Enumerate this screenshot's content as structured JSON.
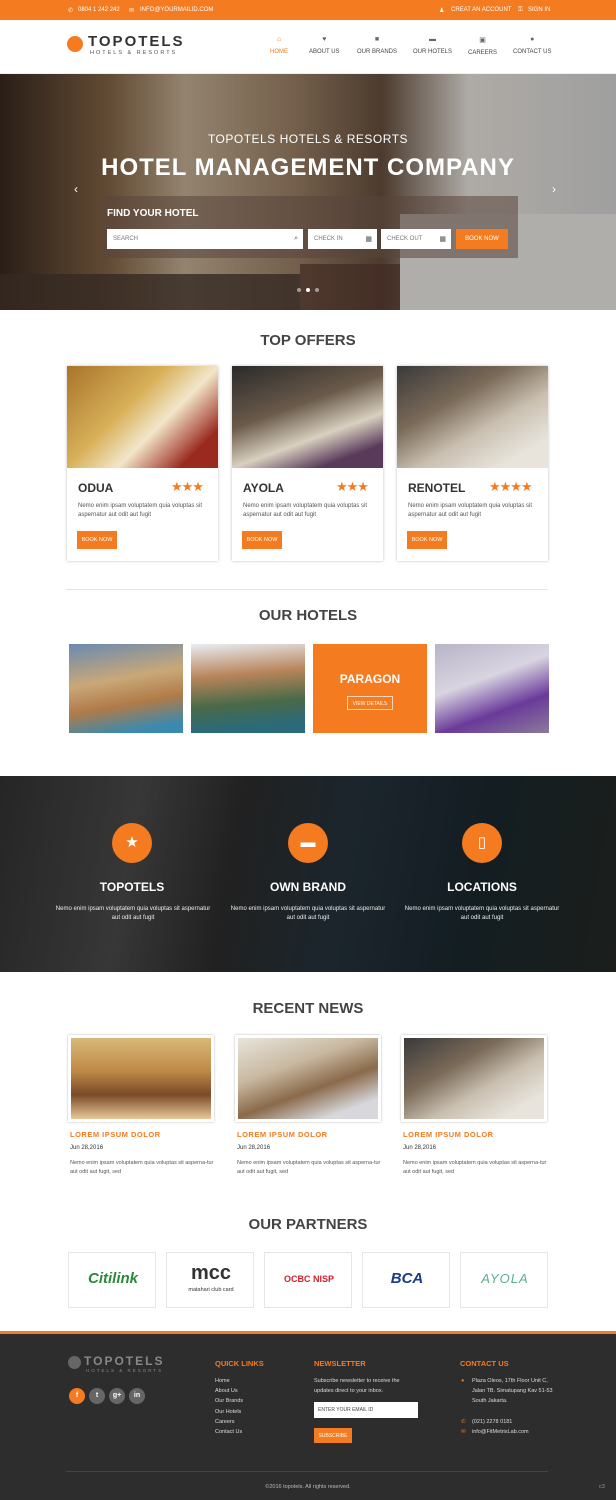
{
  "topbar": {
    "phone": "0804 1 242 242",
    "email": "INFO@YOURMAILID.COM",
    "create_account": "CREAT AN ACCOUNT",
    "sign_in": "SIGN IN"
  },
  "brand": {
    "name": "TOPOTELS",
    "tagline": "HOTELS & RESORTS",
    "accent": "#f47b20"
  },
  "nav": [
    {
      "label": "HOME",
      "icon": "home-icon",
      "glyph": "⌂"
    },
    {
      "label": "ABOUT US",
      "icon": "glass-icon",
      "glyph": "♥"
    },
    {
      "label": "OUR BRANDS",
      "icon": "book-icon",
      "glyph": "■"
    },
    {
      "label": "OUR HOTELS",
      "icon": "bed-icon",
      "glyph": "▬"
    },
    {
      "label": "CAREERS",
      "icon": "briefcase-icon",
      "glyph": "▣"
    },
    {
      "label": "CONTACT US",
      "icon": "map-marker-icon",
      "glyph": "●"
    }
  ],
  "hero": {
    "subtitle": "TOPOTELS HOTELS & RESORTS",
    "title": "HOTEL MANAGEMENT COMPANY",
    "find_label": "FIND YOUR HOTEL",
    "search_placeholder": "SEARCH",
    "checkin_placeholder": "CHECK IN",
    "checkout_placeholder": "CHECK OUT",
    "book_label": "BOOK NOW"
  },
  "offers": {
    "title": "TOP OFFERS",
    "items": [
      {
        "name": "ODUA",
        "stars": "★★★",
        "desc": "Nemo enim ipsam voluptatem quia voluptas sit aspernatur aut odit aut fugit",
        "button": "BOOK NOW"
      },
      {
        "name": "AYOLA",
        "stars": "★★★",
        "desc": "Nemo enim ipsam voluptatem quia voluptas sit aspernatur aut odit aut fugit",
        "button": "BOOK NOW"
      },
      {
        "name": "RENOTEL",
        "stars": "★★★★",
        "desc": "Nemo enim ipsam voluptatem quia voluptas sit aspernatur aut odit aut fugit",
        "button": "BOOK NOW"
      }
    ]
  },
  "hotels": {
    "title": "OUR HOTELS",
    "featured_name": "PARAGON",
    "featured_button": "VIEW DETAILS"
  },
  "features": [
    {
      "title": "TOPOTELS",
      "icon": "star-icon",
      "glyph": "★",
      "desc": "Nemo enim ipsam voluptatem quia voluptas sit aspernatur aut odit aut fugit"
    },
    {
      "title": "OWN BRAND",
      "icon": "bed-icon",
      "glyph": "▬",
      "desc": "Nemo enim ipsam voluptatem quia voluptas sit aspernatur aut odit aut fugit"
    },
    {
      "title": "LOCATIONS",
      "icon": "phone-icon",
      "glyph": "▯",
      "desc": "Nemo enim ipsam voluptatem quia voluptas sit aspernatur aut odit aut fugit"
    }
  ],
  "news": {
    "title": "RECENT NEWS",
    "items": [
      {
        "title": "LOREM IPSUM DOLOR",
        "date": "Jun 28,2016",
        "text": "Nemo enim ipsam voluptatem quia voluptas sit asperna-tur aut odit aut fugit, sed"
      },
      {
        "title": "LOREM IPSUM DOLOR",
        "date": "Jun 28,2016",
        "text": "Nemo enim ipsam voluptatem quia voluptas sit asperna-tur aut odit aut fugit, sed"
      },
      {
        "title": "LOREM IPSUM DOLOR",
        "date": "Jun 28,2016",
        "text": "Nemo enim ipsam voluptatem quia voluptas sit asperna-tur aut odit aut fugit, sed"
      }
    ]
  },
  "partners": {
    "title": "OUR PARTNERS",
    "items": [
      {
        "name": "Citilink",
        "sub": ""
      },
      {
        "name": "mcc",
        "sub": "matahari club card"
      },
      {
        "name": "OCBC NISP",
        "sub": ""
      },
      {
        "name": "BCA",
        "sub": ""
      },
      {
        "name": "AYOLA",
        "sub": ""
      }
    ]
  },
  "footer": {
    "quick_links_title": "QUICK LINKS",
    "quick_links": [
      "Home",
      "About Us",
      "Our Brands",
      "Our Hotels",
      "Careers",
      "Contact Us"
    ],
    "newsletter_title": "NEWSLETTER",
    "newsletter_text_1": "Subscribe newsletter to receive the",
    "newsletter_text_2": "updates direct to your inbox.",
    "email_placeholder": "ENTER YOUR EMAIL ID",
    "subscribe_label": "SUBSCRIBE",
    "contact_title": "CONTACT US",
    "address_1": "Plaza Oleos, 17th Floor Unit C,",
    "address_2": "Jalan TB. Simatupang Kav 51-53",
    "address_3": "South Jakarta.",
    "phone": "(021) 2278 0181",
    "email": "info@FitMetrixLab.com",
    "social": [
      "f",
      "t",
      "g+",
      "in"
    ],
    "copyright": "©2016 topotels. All rights reserved.",
    "corner": "c3"
  }
}
